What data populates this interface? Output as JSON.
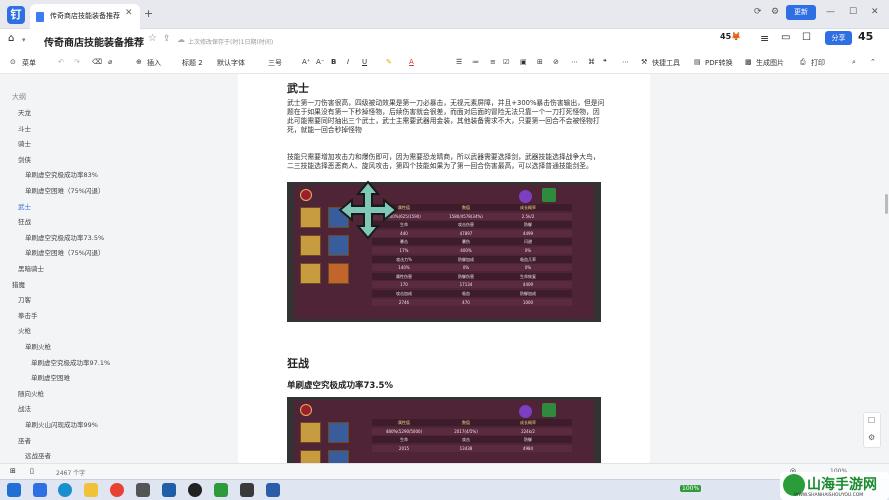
{
  "tab": {
    "title": "传奇商店技能装备推荐",
    "close": "✕",
    "add": "+"
  },
  "window": {
    "update_label": "更新",
    "minimize": "—",
    "maximize": "☐",
    "close": "✕"
  },
  "header": {
    "doc_title": "传奇商店技能装备推荐",
    "save_info": "上次修改保存于(时)1日期(时间)",
    "points": "45",
    "share_label": "分享",
    "avatar": "45"
  },
  "toolbar": {
    "outline": "菜单",
    "insert": "插入",
    "heading": "标题 2",
    "font": "默认字体",
    "size": "三号",
    "bold": "B",
    "italic": "I",
    "underline": "U",
    "color": "A",
    "tools": "快捷工具",
    "pdf": "PDF转换",
    "longimg": "生成图片",
    "print": "打印"
  },
  "sidebar": {
    "header": "大纲",
    "items": [
      {
        "label": "天龙",
        "level": 1,
        "active": false
      },
      {
        "label": "斗士",
        "level": 1,
        "active": false
      },
      {
        "label": "骑士",
        "level": 1,
        "active": false
      },
      {
        "label": "剑侠",
        "level": 1,
        "active": false
      },
      {
        "label": "单刷虚空究极成功率83%",
        "level": 2,
        "active": false
      },
      {
        "label": "单刷虚空困难（75%闪退）",
        "level": 2,
        "active": false
      },
      {
        "label": "武士",
        "level": 1,
        "active": true
      },
      {
        "label": "狂战",
        "level": 1,
        "active": false
      },
      {
        "label": "单刷虚空究极成功率73.5%",
        "level": 2,
        "active": false
      },
      {
        "label": "单刷虚空困难（75%闪退）",
        "level": 2,
        "active": false
      },
      {
        "label": "黑暗骑士",
        "level": 1,
        "active": false
      },
      {
        "label": "猎魔",
        "level": 0,
        "active": false
      },
      {
        "label": "刀客",
        "level": 1,
        "active": false
      },
      {
        "label": "拳击手",
        "level": 1,
        "active": false
      },
      {
        "label": "火枪",
        "level": 1,
        "active": false
      },
      {
        "label": "单刷火枪",
        "level": 2,
        "active": false
      },
      {
        "label": "单刷虚空究极成功率97.1%",
        "level": 3,
        "active": false
      },
      {
        "label": "单刷虚空困难",
        "level": 3,
        "active": false
      },
      {
        "label": "随向火枪",
        "level": 1,
        "active": false
      },
      {
        "label": "战法",
        "level": 1,
        "active": false
      },
      {
        "label": "单刷火山闪现成功率99%",
        "level": 2,
        "active": false
      },
      {
        "label": "巫者",
        "level": 1,
        "active": false
      },
      {
        "label": "远战巫者",
        "level": 2,
        "active": false
      }
    ]
  },
  "page": {
    "h_wushi": "武士",
    "p1": "武士第一刀伤害很高，四级被动效果是第一刀必暴击，无视元素屏障，并且+300%暴击伤害输出，但是问题在于如果没有第一下秒掉怪物，后续伤害就会很差，而面对后面的冒险无法只靠一个一刀打死怪物，因此可能需要同时抽出三个武士，武士主需要武器用金装，其他装备需求不大，只要第一回合不会被怪物打死，就能一回合秒掉怪物",
    "p2": "技能只需要增加攻击力和爆伤即可，因为需要恐龙晴商，所以武器需要选择剑，武器技能选择战争大鸟，二三技能选择恶恶商人、旋风攻击，第四个技能如果为了第一回合伤害最高，可以选择普通技能剑圣。",
    "h_kz": "狂战",
    "h_kz2": "单刷虚空究极成功率73.5%"
  },
  "game_table1": {
    "headers": [
      "属性值",
      "数值",
      "成长概率"
    ],
    "rows": [
      [
        "200%(625/1590)",
        "1580/4578(34%)",
        "2.5k/2"
      ],
      [
        "生命",
        "攻击伤害",
        "防御"
      ],
      [
        "440",
        "47897",
        "4499"
      ],
      [
        "暴击",
        "暴伤",
        "闪避"
      ],
      [
        "17%",
        "400%",
        "0%"
      ],
      [
        "攻击力%",
        "防御加成",
        "吸血几率"
      ],
      [
        "140%",
        "0%",
        "0%"
      ],
      [
        "属性伤害",
        "防御伤害",
        "生命恢复"
      ],
      [
        "170",
        "17134",
        "4409"
      ],
      [
        "攻击加成",
        "吸血",
        "防御加成"
      ],
      [
        "2746",
        "470",
        "1000"
      ]
    ]
  },
  "game_table2": {
    "headers": [
      "属性值",
      "数值",
      "成长概率"
    ],
    "rows": [
      [
        "480%(5290/5000)",
        "2017(4/5%)",
        "224k/2"
      ],
      [
        "生命",
        "攻击",
        "防御"
      ],
      [
        "2015",
        "13438",
        "4984"
      ]
    ]
  },
  "statusbar": {
    "pages": "2467 个字",
    "zoom": "100%"
  },
  "taskbar": {
    "battery": "100%"
  },
  "watermark": {
    "text": "山海手游网",
    "url": "WWW.SHANHAISHOUYOU.COM"
  }
}
